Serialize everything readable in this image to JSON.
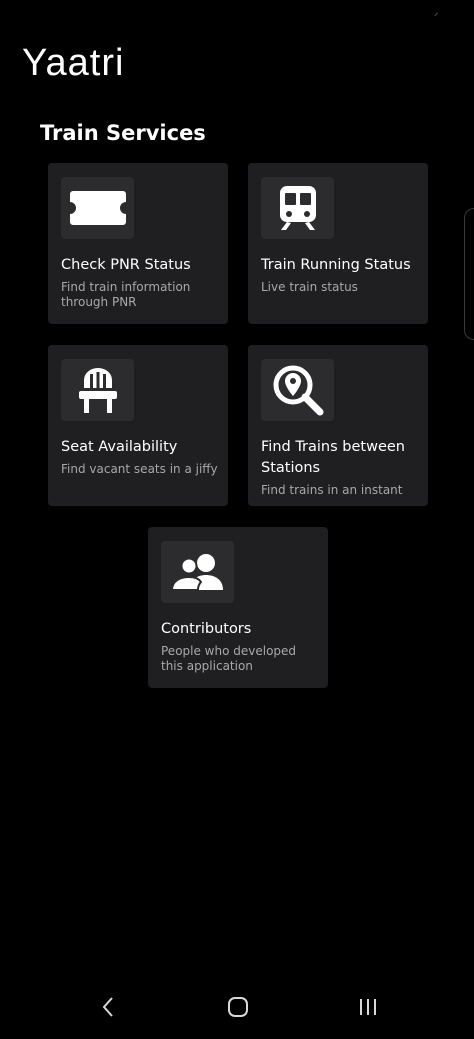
{
  "app": {
    "title": "Yaatri"
  },
  "section": {
    "title": "Train Services"
  },
  "cards": [
    {
      "icon": "ticket-icon",
      "title": "Check PNR Status",
      "subtitle": "Find train information through PNR"
    },
    {
      "icon": "train-icon",
      "title": "Train Running Status",
      "subtitle": "Live train status"
    },
    {
      "icon": "chair-icon",
      "title": "Seat Availability",
      "subtitle": "Find vacant seats in a jiffy"
    },
    {
      "icon": "location-search-icon",
      "title": "Find Trains between Stations",
      "subtitle": "Find trains in an instant"
    },
    {
      "icon": "people-icon",
      "title": "Contributors",
      "subtitle": "People who developed this application"
    }
  ],
  "navigation": {
    "back": "chevron-left-icon",
    "home": "home-outline-icon",
    "recents": "recents-lines-icon"
  },
  "colors": {
    "background": "#000000",
    "card": "#1f1f21",
    "icon_box": "#2c2c2f",
    "title_text": "#ffffff",
    "subtitle_text": "#a8a8a8"
  }
}
